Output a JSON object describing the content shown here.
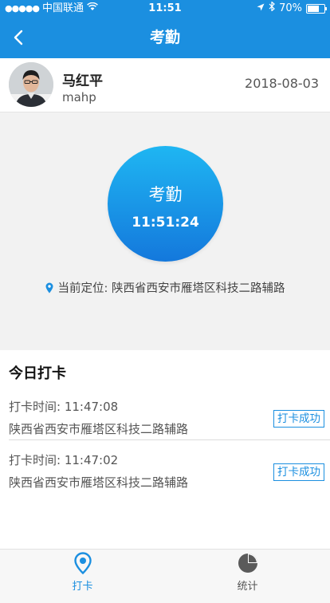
{
  "status_bar": {
    "carrier": "中国联通",
    "time": "11:51",
    "battery": "70%",
    "battery_level": 0.7
  },
  "nav": {
    "title": "考勤"
  },
  "user": {
    "name": "马红平",
    "id": "mahp",
    "date": "2018-08-03"
  },
  "punch": {
    "label": "考勤",
    "time": "11:51:24"
  },
  "location": {
    "text": "当前定位: 陕西省西安市雁塔区科技二路辅路"
  },
  "today": {
    "title": "今日打卡",
    "records": [
      {
        "time": "打卡时间:   11:47:08",
        "address": "陕西省西安市雁塔区科技二路辅路",
        "status": "打卡成功"
      },
      {
        "time": "打卡时间:   11:47:02",
        "address": "陕西省西安市雁塔区科技二路辅路",
        "status": "打卡成功"
      }
    ]
  },
  "tabs": [
    {
      "label": "打卡",
      "icon": "location-pin-icon",
      "active": true
    },
    {
      "label": "统计",
      "icon": "pie-chart-icon",
      "active": false
    }
  ],
  "colors": {
    "primary": "#1b8fe0",
    "inactive": "#555555"
  }
}
